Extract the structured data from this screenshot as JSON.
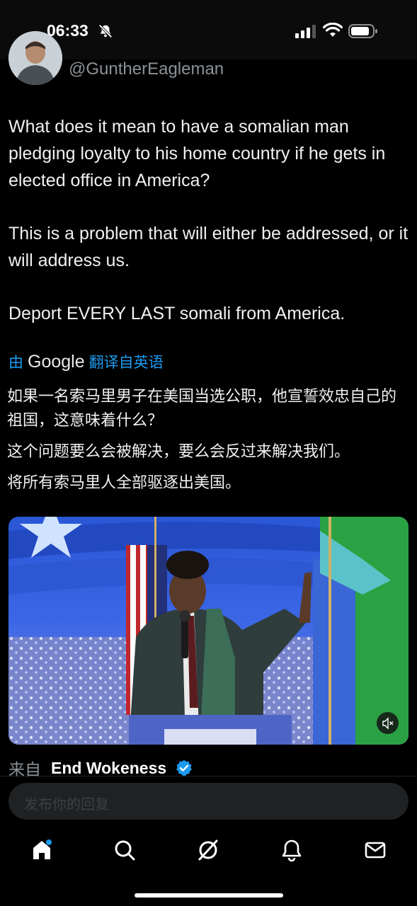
{
  "status_bar": {
    "time": "06:33",
    "icons": [
      "bell-off-icon",
      "signal-icon",
      "wifi-icon",
      "battery-icon"
    ]
  },
  "tweet": {
    "handle": "@GuntherEagleman",
    "paragraphs": [
      "What does it mean to have a somalian man pledging loyalty to his home country if he gets in elected office in America?",
      "This is a problem that will either be addressed, or it will address us.",
      "Deport EVERY LAST somali from America."
    ]
  },
  "translation": {
    "prefix": "由",
    "provider": "Google",
    "suffix": "翻译自英语",
    "paragraphs": [
      "如果一名索马里男子在美国当选公职，他宣誓效忠自己的祖国，这意味着什么？",
      "这个问题要么会被解决，要么会反过来解决我们。",
      "将所有索马里人全部驱逐出美国。"
    ]
  },
  "media": {
    "mute_icon": "speaker-muted-icon"
  },
  "source": {
    "prefix": "来自",
    "name": "End Wokeness",
    "badge": "verified-icon"
  },
  "reply": {
    "placeholder": "发布你的回复"
  },
  "nav": {
    "items": [
      "home-icon",
      "search-icon",
      "grok-icon",
      "notifications-icon",
      "messages-icon"
    ]
  },
  "colors": {
    "accent": "#1d9bf0",
    "background": "#000000",
    "text": "#e7e9ea",
    "muted": "#8b9196"
  }
}
